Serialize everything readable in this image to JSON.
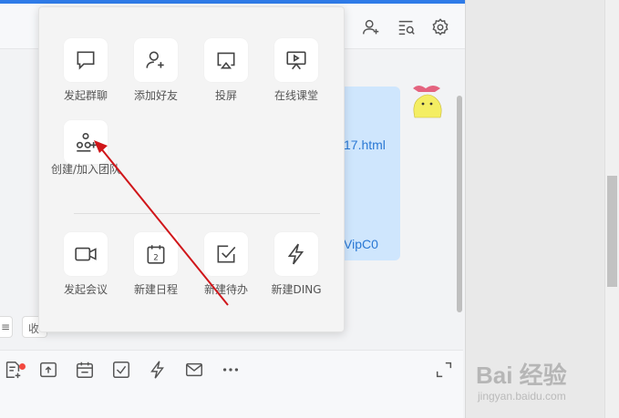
{
  "header": {
    "icons": [
      "add-member-icon",
      "search-list-icon",
      "settings-icon"
    ]
  },
  "chat": {
    "link_text_1": "17.html",
    "link_text_2": "VipC0"
  },
  "chips": [
    "≡",
    "收"
  ],
  "popup": {
    "row1": [
      {
        "label": "发起群聊",
        "icon": "chat-bubble-icon"
      },
      {
        "label": "添加好友",
        "icon": "add-friend-icon"
      },
      {
        "label": "投屏",
        "icon": "screen-cast-icon"
      },
      {
        "label": "在线课堂",
        "icon": "online-classroom-icon"
      }
    ],
    "row2": [
      {
        "label": "创建/加入团队",
        "icon": "create-team-icon"
      }
    ],
    "row3": [
      {
        "label": "发起会议",
        "icon": "video-meeting-icon"
      },
      {
        "label": "新建日程",
        "icon": "calendar-icon"
      },
      {
        "label": "新建待办",
        "icon": "todo-check-icon"
      },
      {
        "label": "新建DING",
        "icon": "ding-lightning-icon"
      }
    ],
    "calendar_day": "2"
  },
  "toolbar": {
    "icons": [
      "doc-add-icon",
      "upload-file-icon",
      "calendar-icon",
      "checkbox-icon",
      "lightning-icon",
      "mail-icon",
      "more-icon",
      "expand-icon"
    ]
  },
  "watermark": {
    "brand": "Bai 经验",
    "url": "jingyan.baidu.com"
  },
  "colors": {
    "accent": "#2f7be8",
    "bubble": "#cfe6fd",
    "arrow": "#d0161a"
  }
}
